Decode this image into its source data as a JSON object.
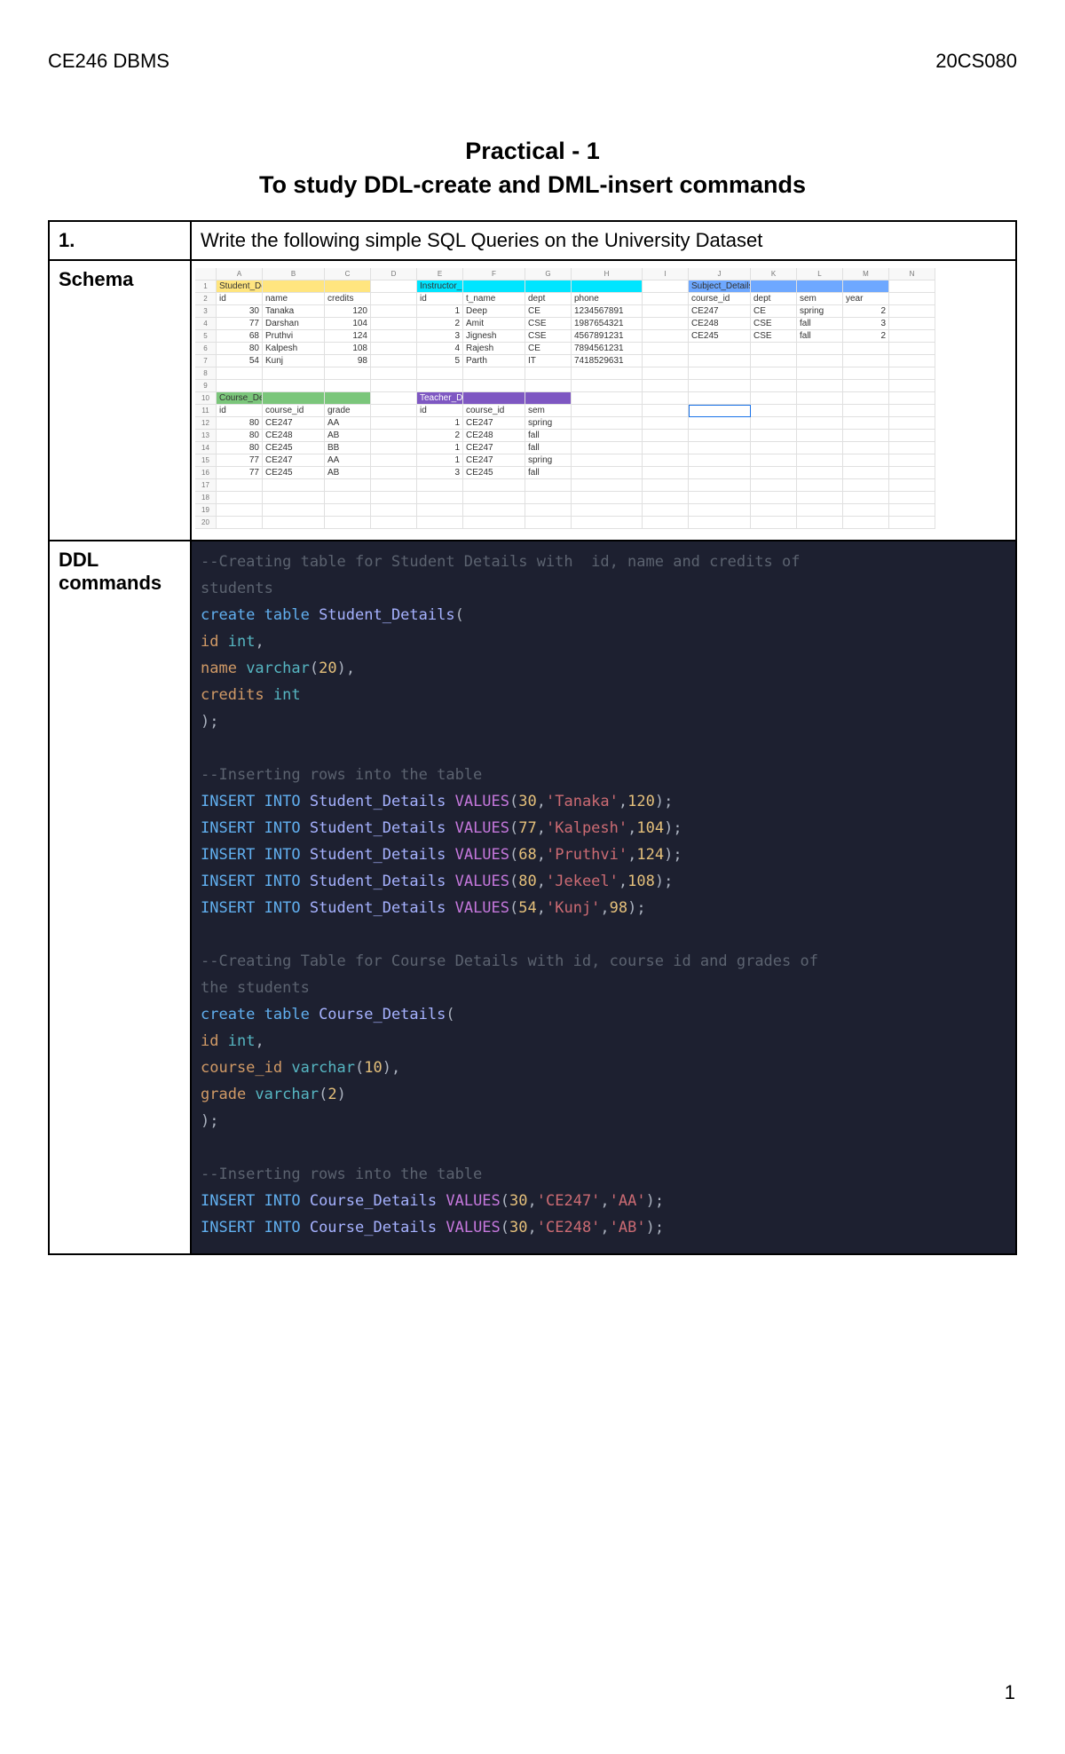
{
  "header": {
    "left": "CE246 DBMS",
    "right": "20CS080"
  },
  "title": {
    "line1": "Practical - 1",
    "line2": "To study DDL-create and DML-insert commands"
  },
  "rows": {
    "r1_label": "1.",
    "r1_text": "Write the following simple SQL Queries on the University Dataset",
    "r2_label": "Schema",
    "r3_label": "DDL commands"
  },
  "spreadsheet": {
    "columns": [
      "A",
      "B",
      "C",
      "D",
      "E",
      "F",
      "G",
      "H",
      "I",
      "J",
      "K",
      "L",
      "M",
      "N"
    ],
    "row_numbers": [
      "1",
      "2",
      "3",
      "4",
      "5",
      "6",
      "7",
      "8",
      "9",
      "10",
      "11",
      "12",
      "13",
      "14",
      "15",
      "16",
      "17",
      "18",
      "19",
      "20"
    ],
    "student_details_label": "Student_Details",
    "student_details_header": [
      "id",
      "name",
      "credits"
    ],
    "student_details": [
      [
        "30",
        "Tanaka",
        "120"
      ],
      [
        "77",
        "Darshan",
        "104"
      ],
      [
        "68",
        "Pruthvi",
        "124"
      ],
      [
        "80",
        "Kalpesh",
        "108"
      ],
      [
        "54",
        "Kunj",
        "98"
      ]
    ],
    "instructor_details_label": "Instructor_Details",
    "instructor_details_header": [
      "id",
      "t_name",
      "dept",
      "phone"
    ],
    "instructor_details": [
      [
        "1",
        "Deep",
        "CE",
        "1234567891"
      ],
      [
        "2",
        "Amit",
        "CSE",
        "1987654321"
      ],
      [
        "3",
        "Jignesh",
        "CSE",
        "4567891231"
      ],
      [
        "4",
        "Rajesh",
        "CE",
        "7894561231"
      ],
      [
        "5",
        "Parth",
        "IT",
        "7418529631"
      ]
    ],
    "subject_details_label": "Subject_Details",
    "subject_details_header": [
      "course_id",
      "dept",
      "sem",
      "year"
    ],
    "subject_details": [
      [
        "CE247",
        "CE",
        "spring",
        "2"
      ],
      [
        "CE248",
        "CSE",
        "fall",
        "3"
      ],
      [
        "CE245",
        "CSE",
        "fall",
        "2"
      ]
    ],
    "course_details_label": "Course_Details",
    "course_details_header": [
      "id",
      "course_id",
      "grade"
    ],
    "course_details": [
      [
        "80",
        "CE247",
        "AA"
      ],
      [
        "80",
        "CE248",
        "AB"
      ],
      [
        "80",
        "CE245",
        "BB"
      ],
      [
        "77",
        "CE247",
        "AA"
      ],
      [
        "77",
        "CE245",
        "AB"
      ]
    ],
    "teacher_details_label": "Teacher_Details",
    "teacher_details_header": [
      "id",
      "course_id",
      "sem"
    ],
    "teacher_details": [
      [
        "1",
        "CE247",
        "spring"
      ],
      [
        "2",
        "CE248",
        "fall"
      ],
      [
        "1",
        "CE247",
        "fall"
      ],
      [
        "1",
        "CE247",
        "spring"
      ],
      [
        "3",
        "CE245",
        "fall"
      ]
    ]
  },
  "code_tokens": [
    [
      [
        "cm",
        "--Creating table for Student Details with  id, name and credits of"
      ]
    ],
    [
      [
        "cm",
        "students"
      ]
    ],
    [
      [
        "kw1",
        "create table "
      ],
      [
        "tbl",
        "Student_Details"
      ],
      [
        "pun",
        "("
      ]
    ],
    [
      [
        "fld",
        "id "
      ],
      [
        "typ",
        "int"
      ],
      [
        "pun",
        ","
      ]
    ],
    [
      [
        "fld",
        "name "
      ],
      [
        "typ",
        "varchar"
      ],
      [
        "pun",
        "("
      ],
      [
        "num",
        "20"
      ],
      [
        "pun",
        ")"
      ],
      [
        "pun",
        ","
      ]
    ],
    [
      [
        "fld",
        "credits "
      ],
      [
        "typ",
        "int"
      ]
    ],
    [
      [
        "pun",
        ");"
      ]
    ],
    [
      [
        "",
        ""
      ]
    ],
    [
      [
        "cm",
        "--Inserting rows into the table"
      ]
    ],
    [
      [
        "kw1",
        "INSERT INTO "
      ],
      [
        "tbl",
        "Student_Details "
      ],
      [
        "kw2",
        "VALUES"
      ],
      [
        "pun",
        "("
      ],
      [
        "num",
        "30"
      ],
      [
        "pun",
        ","
      ],
      [
        "str",
        "'Tanaka'"
      ],
      [
        "pun",
        ","
      ],
      [
        "num",
        "120"
      ],
      [
        "pun",
        ");"
      ]
    ],
    [
      [
        "kw1",
        "INSERT INTO "
      ],
      [
        "tbl",
        "Student_Details "
      ],
      [
        "kw2",
        "VALUES"
      ],
      [
        "pun",
        "("
      ],
      [
        "num",
        "77"
      ],
      [
        "pun",
        ","
      ],
      [
        "str",
        "'Kalpesh'"
      ],
      [
        "pun",
        ","
      ],
      [
        "num",
        "104"
      ],
      [
        "pun",
        ");"
      ]
    ],
    [
      [
        "kw1",
        "INSERT INTO "
      ],
      [
        "tbl",
        "Student_Details "
      ],
      [
        "kw2",
        "VALUES"
      ],
      [
        "pun",
        "("
      ],
      [
        "num",
        "68"
      ],
      [
        "pun",
        ","
      ],
      [
        "str",
        "'Pruthvi'"
      ],
      [
        "pun",
        ","
      ],
      [
        "num",
        "124"
      ],
      [
        "pun",
        ");"
      ]
    ],
    [
      [
        "kw1",
        "INSERT INTO "
      ],
      [
        "tbl",
        "Student_Details "
      ],
      [
        "kw2",
        "VALUES"
      ],
      [
        "pun",
        "("
      ],
      [
        "num",
        "80"
      ],
      [
        "pun",
        ","
      ],
      [
        "str",
        "'Jekeel'"
      ],
      [
        "pun",
        ","
      ],
      [
        "num",
        "108"
      ],
      [
        "pun",
        ");"
      ]
    ],
    [
      [
        "kw1",
        "INSERT INTO "
      ],
      [
        "tbl",
        "Student_Details "
      ],
      [
        "kw2",
        "VALUES"
      ],
      [
        "pun",
        "("
      ],
      [
        "num",
        "54"
      ],
      [
        "pun",
        ","
      ],
      [
        "str",
        "'Kunj'"
      ],
      [
        "pun",
        ","
      ],
      [
        "num",
        "98"
      ],
      [
        "pun",
        ");"
      ]
    ],
    [
      [
        "",
        ""
      ]
    ],
    [
      [
        "cm",
        "--Creating Table for Course Details with id, course id and grades of"
      ]
    ],
    [
      [
        "cm",
        "the students"
      ]
    ],
    [
      [
        "kw1",
        "create table "
      ],
      [
        "tbl",
        "Course_Details"
      ],
      [
        "pun",
        "("
      ]
    ],
    [
      [
        "fld",
        "id "
      ],
      [
        "typ",
        "int"
      ],
      [
        "pun",
        ","
      ]
    ],
    [
      [
        "fld",
        "course_id "
      ],
      [
        "typ",
        "varchar"
      ],
      [
        "pun",
        "("
      ],
      [
        "num",
        "10"
      ],
      [
        "pun",
        ")"
      ],
      [
        "pun",
        ","
      ]
    ],
    [
      [
        "fld",
        "grade "
      ],
      [
        "typ",
        "varchar"
      ],
      [
        "pun",
        "("
      ],
      [
        "num",
        "2"
      ],
      [
        "pun",
        ")"
      ]
    ],
    [
      [
        "pun",
        ");"
      ]
    ],
    [
      [
        "",
        ""
      ]
    ],
    [
      [
        "cm",
        "--Inserting rows into the table"
      ]
    ],
    [
      [
        "kw1",
        "INSERT INTO "
      ],
      [
        "tbl",
        "Course_Details "
      ],
      [
        "kw2",
        "VALUES"
      ],
      [
        "pun",
        "("
      ],
      [
        "num",
        "30"
      ],
      [
        "pun",
        ","
      ],
      [
        "str",
        "'CE247'"
      ],
      [
        "pun",
        ","
      ],
      [
        "str",
        "'AA'"
      ],
      [
        "pun",
        ");"
      ]
    ],
    [
      [
        "kw1",
        "INSERT INTO "
      ],
      [
        "tbl",
        "Course_Details "
      ],
      [
        "kw2",
        "VALUES"
      ],
      [
        "pun",
        "("
      ],
      [
        "num",
        "30"
      ],
      [
        "pun",
        ","
      ],
      [
        "str",
        "'CE248'"
      ],
      [
        "pun",
        ","
      ],
      [
        "str",
        "'AB'"
      ],
      [
        "pun",
        ");"
      ]
    ]
  ],
  "page_number": "1"
}
